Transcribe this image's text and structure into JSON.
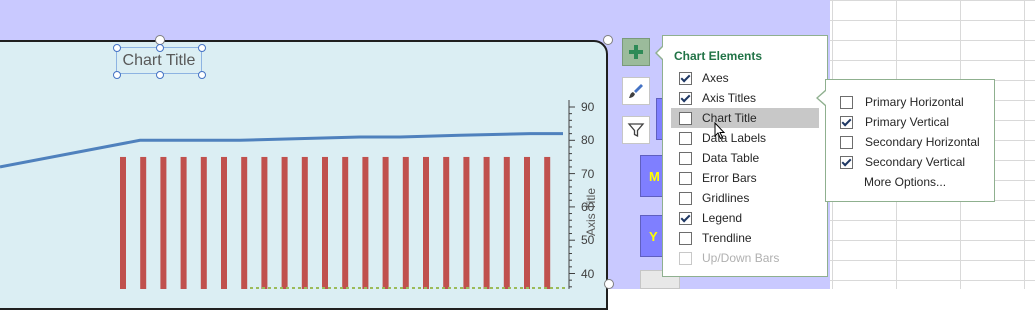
{
  "chart": {
    "title_placeholder": "Chart Title",
    "axis_title": "Axis Title",
    "y_ticks": [
      "90",
      "80",
      "70",
      "60",
      "50",
      "40"
    ],
    "bar_color": "#c0504d",
    "line_color": "#4f81bd",
    "bar_value": 75,
    "line_values": [
      72,
      80,
      80,
      80,
      80.5,
      81,
      81,
      81.5,
      82,
      82
    ]
  },
  "side_buttons": [
    {
      "name": "chart-elements",
      "icon": "plus-icon"
    },
    {
      "name": "chart-styles",
      "icon": "brush-icon"
    },
    {
      "name": "chart-filters",
      "icon": "filter-icon"
    }
  ],
  "sheet_buttons": [
    {
      "label": "M"
    },
    {
      "label": "Y"
    }
  ],
  "panel": {
    "title": "Chart Elements",
    "items": [
      {
        "label": "Axes",
        "checked": true
      },
      {
        "label": "Axis Titles",
        "checked": true,
        "has_submenu": true
      },
      {
        "label": "Chart Title",
        "checked": false,
        "has_submenu": true,
        "hover": true
      },
      {
        "label": "Data Labels",
        "checked": false
      },
      {
        "label": "Data Table",
        "checked": false
      },
      {
        "label": "Error Bars",
        "checked": false
      },
      {
        "label": "Gridlines",
        "checked": false
      },
      {
        "label": "Legend",
        "checked": true
      },
      {
        "label": "Trendline",
        "checked": false
      },
      {
        "label": "Up/Down Bars",
        "checked": false,
        "disabled": true
      }
    ]
  },
  "submenu": {
    "items": [
      {
        "label": "Primary Horizontal",
        "checked": false
      },
      {
        "label": "Primary Vertical",
        "checked": true
      },
      {
        "label": "Secondary Horizontal",
        "checked": false
      },
      {
        "label": "Secondary Vertical",
        "checked": true
      }
    ],
    "more_options": "More Options..."
  }
}
